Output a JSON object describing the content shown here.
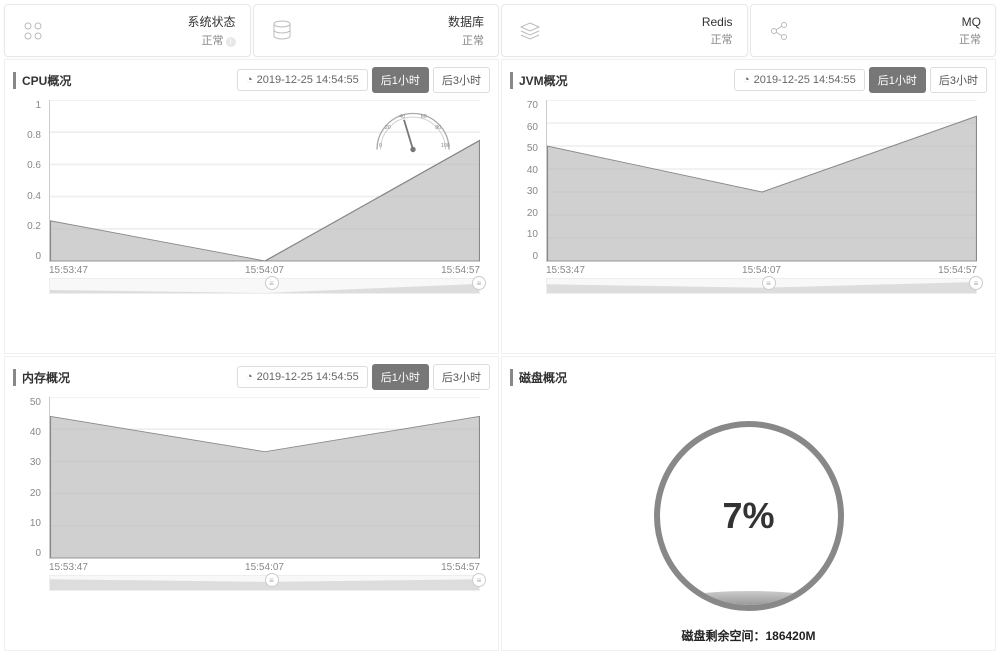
{
  "status": {
    "sys": {
      "title": "系统状态",
      "value": "正常"
    },
    "db": {
      "title": "数据库",
      "value": "正常"
    },
    "redis": {
      "title": "Redis",
      "value": "正常"
    },
    "mq": {
      "title": "MQ",
      "value": "正常"
    }
  },
  "datetime": "2019-12-25 14:54:55",
  "btn_1h": "后1小时",
  "btn_3h": "后3小时",
  "panels": {
    "cpu": {
      "title": "CPU概况"
    },
    "jvm": {
      "title": "JVM概况"
    },
    "mem": {
      "title": "内存概况"
    },
    "disk": {
      "title": "磁盘概况"
    }
  },
  "disk": {
    "pct": "7%",
    "label_prefix": "磁盘剩余空间：",
    "free": "186420M"
  },
  "x_ticks": [
    "15:53:47",
    "15:54:07",
    "15:54:57"
  ],
  "chart_data": [
    {
      "id": "cpu",
      "type": "area",
      "x": [
        "15:53:47",
        "15:54:07",
        "15:54:57"
      ],
      "values": [
        0.25,
        0,
        0.75
      ],
      "y_ticks": [
        0,
        0.2,
        0.4,
        0.6,
        0.8,
        1
      ],
      "ylim": [
        0,
        1
      ],
      "title": "CPU概况",
      "xlabel": "",
      "ylabel": ""
    },
    {
      "id": "jvm",
      "type": "area",
      "x": [
        "15:53:47",
        "15:54:07",
        "15:54:57"
      ],
      "values": [
        50,
        30,
        63
      ],
      "y_ticks": [
        0,
        10,
        20,
        30,
        40,
        50,
        60,
        70
      ],
      "ylim": [
        0,
        70
      ],
      "title": "JVM概况",
      "xlabel": "",
      "ylabel": ""
    },
    {
      "id": "mem",
      "type": "area",
      "x": [
        "15:53:47",
        "15:54:07",
        "15:54:57"
      ],
      "values": [
        44,
        33,
        44
      ],
      "y_ticks": [
        0,
        10,
        20,
        30,
        40,
        50
      ],
      "ylim": [
        0,
        50
      ],
      "title": "内存概况",
      "xlabel": "",
      "ylabel": ""
    }
  ],
  "gauge": {
    "ticks": [
      0,
      20,
      40,
      60,
      80,
      100
    ]
  }
}
